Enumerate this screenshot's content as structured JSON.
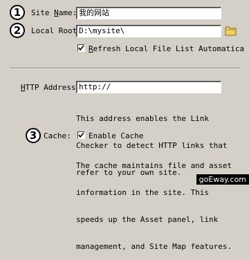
{
  "site_name": {
    "badge": "1",
    "label_pre": "Site ",
    "label_ul": "N",
    "label_post": "ame:",
    "value": "我的网站"
  },
  "local_root": {
    "badge": "2",
    "label": "Local Root",
    "value": "D:\\mysite\\"
  },
  "refresh": {
    "label_ul": "R",
    "label_rest": "efresh Local File List Automatica",
    "checked": true
  },
  "http": {
    "label_ul": "H",
    "label_rest": "TTP Address:",
    "value": "http://",
    "help": [
      "This address enables the Link",
      "Checker to detect HTTP links that",
      "refer to your own site."
    ]
  },
  "cache": {
    "badge": "3",
    "label": "Cache:",
    "checkbox_label": "Enable Cache",
    "checked": true,
    "help": [
      "The cache maintains file and asset",
      "information in the site. This",
      "speeds up the Asset panel, link",
      "management, and Site Map features."
    ]
  },
  "watermark": "goEway.com"
}
